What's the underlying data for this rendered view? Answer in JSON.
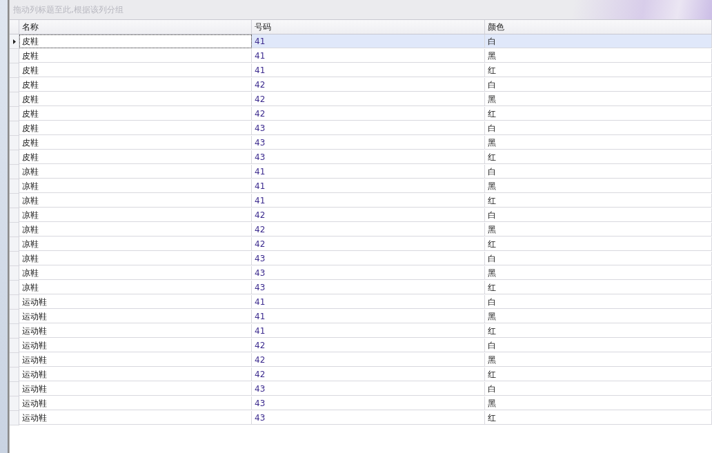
{
  "group_panel": {
    "placeholder": "拖动列标题至此,根据该列分组"
  },
  "table": {
    "columns": [
      "名称",
      "号码",
      "颜色"
    ],
    "rows": [
      {
        "cells": [
          "皮鞋",
          "41",
          "白"
        ],
        "selected": true
      },
      {
        "cells": [
          "皮鞋",
          "41",
          "黑"
        ],
        "selected": false
      },
      {
        "cells": [
          "皮鞋",
          "41",
          "红"
        ],
        "selected": false
      },
      {
        "cells": [
          "皮鞋",
          "42",
          "白"
        ],
        "selected": false
      },
      {
        "cells": [
          "皮鞋",
          "42",
          "黑"
        ],
        "selected": false
      },
      {
        "cells": [
          "皮鞋",
          "42",
          "红"
        ],
        "selected": false
      },
      {
        "cells": [
          "皮鞋",
          "43",
          "白"
        ],
        "selected": false
      },
      {
        "cells": [
          "皮鞋",
          "43",
          "黑"
        ],
        "selected": false
      },
      {
        "cells": [
          "皮鞋",
          "43",
          "红"
        ],
        "selected": false
      },
      {
        "cells": [
          "凉鞋",
          "41",
          "白"
        ],
        "selected": false
      },
      {
        "cells": [
          "凉鞋",
          "41",
          "黑"
        ],
        "selected": false
      },
      {
        "cells": [
          "凉鞋",
          "41",
          "红"
        ],
        "selected": false
      },
      {
        "cells": [
          "凉鞋",
          "42",
          "白"
        ],
        "selected": false
      },
      {
        "cells": [
          "凉鞋",
          "42",
          "黑"
        ],
        "selected": false
      },
      {
        "cells": [
          "凉鞋",
          "42",
          "红"
        ],
        "selected": false
      },
      {
        "cells": [
          "凉鞋",
          "43",
          "白"
        ],
        "selected": false
      },
      {
        "cells": [
          "凉鞋",
          "43",
          "黑"
        ],
        "selected": false
      },
      {
        "cells": [
          "凉鞋",
          "43",
          "红"
        ],
        "selected": false
      },
      {
        "cells": [
          "运动鞋",
          "41",
          "白"
        ],
        "selected": false
      },
      {
        "cells": [
          "运动鞋",
          "41",
          "黑"
        ],
        "selected": false
      },
      {
        "cells": [
          "运动鞋",
          "41",
          "红"
        ],
        "selected": false
      },
      {
        "cells": [
          "运动鞋",
          "42",
          "白"
        ],
        "selected": false
      },
      {
        "cells": [
          "运动鞋",
          "42",
          "黑"
        ],
        "selected": false
      },
      {
        "cells": [
          "运动鞋",
          "42",
          "红"
        ],
        "selected": false
      },
      {
        "cells": [
          "运动鞋",
          "43",
          "白"
        ],
        "selected": false
      },
      {
        "cells": [
          "运动鞋",
          "43",
          "黑"
        ],
        "selected": false
      },
      {
        "cells": [
          "运动鞋",
          "43",
          "红"
        ],
        "selected": false
      }
    ]
  }
}
